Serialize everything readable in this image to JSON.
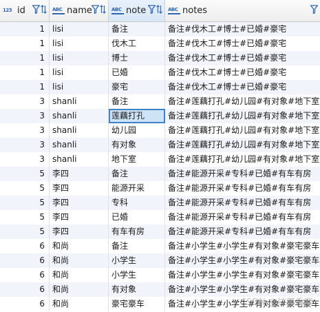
{
  "columns": [
    {
      "type_icon": "123",
      "label": "id"
    },
    {
      "type_icon": "ABC",
      "label": "name"
    },
    {
      "type_icon": "ABC",
      "label": "note"
    },
    {
      "type_icon": "ABC",
      "label": "notes"
    }
  ],
  "rows": [
    [
      "1",
      "lisi",
      "备注",
      "备注#伐木工#博士#已婚#豪宅"
    ],
    [
      "1",
      "lisi",
      "伐木工",
      "备注#伐木工#博士#已婚#豪宅"
    ],
    [
      "1",
      "lisi",
      "博士",
      "备注#伐木工#博士#已婚#豪宅"
    ],
    [
      "1",
      "lisi",
      "已婚",
      "备注#伐木工#博士#已婚#豪宅"
    ],
    [
      "1",
      "lisi",
      "豪宅",
      "备注#伐木工#博士#已婚#豪宅"
    ],
    [
      "3",
      "shanli",
      "备注",
      "备注#莲藕打孔#幼儿园#有对象#地下室"
    ],
    [
      "3",
      "shanli",
      "莲藕打孔",
      "备注#莲藕打孔#幼儿园#有对象#地下室"
    ],
    [
      "3",
      "shanli",
      "幼儿园",
      "备注#莲藕打孔#幼儿园#有对象#地下室"
    ],
    [
      "3",
      "shanli",
      "有对象",
      "备注#莲藕打孔#幼儿园#有对象#地下室"
    ],
    [
      "3",
      "shanli",
      "地下室",
      "备注#莲藕打孔#幼儿园#有对象#地下室"
    ],
    [
      "5",
      "李四",
      "备注",
      "备注#能源开采#专科#已婚#有车有房"
    ],
    [
      "5",
      "李四",
      "能源开采",
      "备注#能源开采#专科#已婚#有车有房"
    ],
    [
      "5",
      "李四",
      "专科",
      "备注#能源开采#专科#已婚#有车有房"
    ],
    [
      "5",
      "李四",
      "已婚",
      "备注#能源开采#专科#已婚#有车有房"
    ],
    [
      "5",
      "李四",
      "有车有房",
      "备注#能源开采#专科#已婚#有车有房"
    ],
    [
      "6",
      "和尚",
      "备注",
      "备注#小学生#小学生#有对象#豪宅豪车"
    ],
    [
      "6",
      "和尚",
      "小学生",
      "备注#小学生#小学生#有对象#豪宅豪车"
    ],
    [
      "6",
      "和尚",
      "小学生",
      "备注#小学生#小学生#有对象#豪宅豪车"
    ],
    [
      "6",
      "和尚",
      "有对象",
      "备注#小学生#小学生#有对象#豪宅豪车"
    ],
    [
      "6",
      "和尚",
      "豪宅豪车",
      "备注#小学生#小学生#有对象#豪宅豪车"
    ]
  ],
  "selected_cell": {
    "row": 6,
    "column": "note"
  },
  "watermark": "CSDN @抹茶香窝",
  "colors": {
    "accent": "#3f82c8",
    "stripe": "#f1f5fb",
    "icon": "#2f67b5"
  }
}
